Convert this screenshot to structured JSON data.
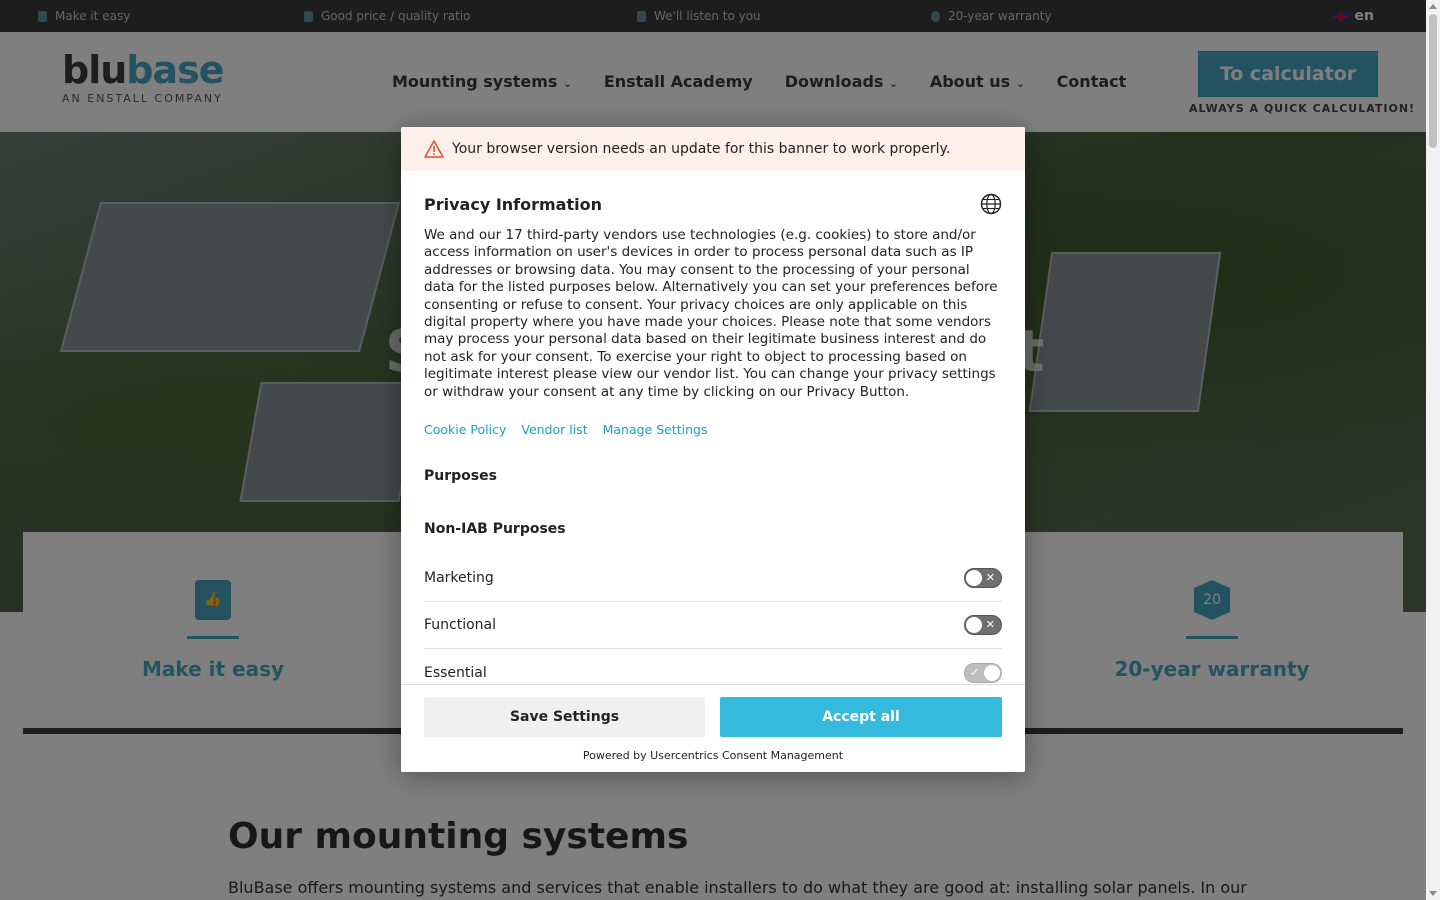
{
  "topbar": {
    "usps": [
      "Make it easy",
      "Good price / quality ratio",
      "We'll listen to you",
      "20-year warranty"
    ],
    "language": "en"
  },
  "header": {
    "logo_part1": "blu",
    "logo_part2": "base",
    "logo_sub": "AN ENSTALL COMPANY",
    "nav": [
      "Mounting systems",
      "Enstall Academy",
      "Downloads",
      "About us",
      "Contact"
    ],
    "calc_button": "To calculator",
    "calc_sub": "ALWAYS A QUICK CALCULATION!"
  },
  "hero": {
    "partial_text_left": "S",
    "partial_text_right": "t"
  },
  "features": {
    "left": "Make it easy",
    "right": "20-year warranty",
    "right_icon_label": "20"
  },
  "section": {
    "title": "Our mounting systems",
    "text": "BluBase offers mounting systems and services that enable installers to do what they are good at: installing solar panels. In our"
  },
  "consent": {
    "warning": "Your browser version needs an update for this banner to work properly.",
    "title": "Privacy Information",
    "body": "We and our 17 third-party vendors use technologies (e.g. cookies) to store and/or access information on user's devices in order to process personal data such as IP addresses or browsing data. You may consent to the processing of your personal data for the listed purposes below. Alternatively you can set your preferences before consenting or refuse to consent. Your privacy choices are only applicable on this digital property where you have made your choices. Please note that some vendors may process your personal data based on their legitimate business interest and do not ask for your consent. To exercise your right to object to processing based on legitimate interest please view our vendor list. You can change your privacy settings or withdraw your consent at any time by clicking on our Privacy Button.",
    "links": [
      "Cookie Policy",
      "Vendor list",
      "Manage Settings"
    ],
    "purposes_heading": "Purposes",
    "non_iab_heading": "Non-IAB Purposes",
    "toggles": [
      {
        "label": "Marketing",
        "on": false
      },
      {
        "label": "Functional",
        "on": false
      },
      {
        "label": "Essential",
        "on": true
      }
    ],
    "save_button": "Save Settings",
    "accept_button": "Accept all",
    "powered_by": "Powered by Usercentrics Consent Management"
  }
}
